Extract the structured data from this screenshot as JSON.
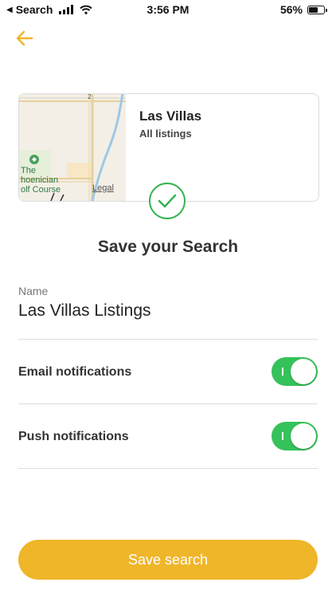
{
  "status_bar": {
    "carrier": "Search",
    "time": "3:56 PM",
    "battery": "56%"
  },
  "nav": {
    "back_icon": "arrow-left-icon",
    "accent": "#efb62a"
  },
  "card": {
    "title": "Las Villas",
    "subtitle": "All listings",
    "map_legal": "Legal",
    "map_poi": "The\nhoenician\nolf Course"
  },
  "heading": "Save your Search",
  "name": {
    "label": "Name",
    "value": "Las Villas Listings"
  },
  "settings": [
    {
      "label": "Email notifications",
      "on": true
    },
    {
      "label": "Push notifications",
      "on": true
    }
  ],
  "save_button": {
    "label": "Save search"
  },
  "colors": {
    "toggle_on": "#35c25a",
    "check": "#34b34f",
    "button": "#efb62a"
  }
}
